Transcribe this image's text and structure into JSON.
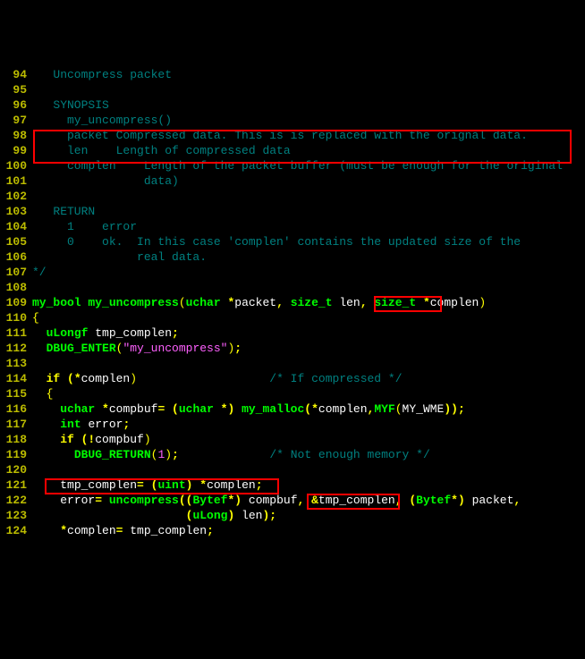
{
  "lines": [
    {
      "n": "94",
      "segs": [
        {
          "t": "   Uncompress packet",
          "c": "comment"
        }
      ]
    },
    {
      "n": "95",
      "segs": [
        {
          "t": " ",
          "c": "comment"
        }
      ]
    },
    {
      "n": "96",
      "segs": [
        {
          "t": "   SYNOPSIS",
          "c": "comment"
        }
      ]
    },
    {
      "n": "97",
      "segs": [
        {
          "t": "     my_uncompress()",
          "c": "comment"
        }
      ]
    },
    {
      "n": "98",
      "segs": [
        {
          "t": "     packet Compressed data. This is is replaced with the orignal data.",
          "c": "comment"
        }
      ]
    },
    {
      "n": "99",
      "segs": [
        {
          "t": "     len    Length of compressed data",
          "c": "comment"
        }
      ]
    },
    {
      "n": "100",
      "segs": [
        {
          "t": "     complen    Length of the packet buffer (must be enough for the original",
          "c": "comment"
        }
      ]
    },
    {
      "n": "101",
      "segs": [
        {
          "t": "                data)",
          "c": "comment"
        }
      ]
    },
    {
      "n": "102",
      "segs": [
        {
          "t": " ",
          "c": "comment"
        }
      ]
    },
    {
      "n": "103",
      "segs": [
        {
          "t": "   RETURN",
          "c": "comment"
        }
      ]
    },
    {
      "n": "104",
      "segs": [
        {
          "t": "     1    error",
          "c": "comment"
        }
      ]
    },
    {
      "n": "105",
      "segs": [
        {
          "t": "     0    ok.  In this case 'complen' contains the updated size of the",
          "c": "comment"
        }
      ]
    },
    {
      "n": "106",
      "segs": [
        {
          "t": "               real data.",
          "c": "comment"
        }
      ]
    },
    {
      "n": "107",
      "segs": [
        {
          "t": "*/",
          "c": "comment"
        }
      ]
    },
    {
      "n": "108",
      "segs": [
        {
          "t": " ",
          "c": "comment"
        }
      ]
    },
    {
      "n": "109",
      "segs": [
        {
          "t": "my_bool ",
          "c": "kw-type"
        },
        {
          "t": "my_uncompress",
          "c": "func"
        },
        {
          "t": "(",
          "c": "paren"
        },
        {
          "t": "uchar ",
          "c": "kw-type"
        },
        {
          "t": "*",
          "c": "punct"
        },
        {
          "t": "packet",
          "c": "ident"
        },
        {
          "t": ", ",
          "c": "punct"
        },
        {
          "t": "size_t ",
          "c": "kw-type"
        },
        {
          "t": "len",
          "c": "ident"
        },
        {
          "t": ", ",
          "c": "punct"
        },
        {
          "t": "size_t ",
          "c": "kw-type"
        },
        {
          "t": "*",
          "c": "punct"
        },
        {
          "t": "complen",
          "c": "ident"
        },
        {
          "t": ")",
          "c": "paren"
        }
      ]
    },
    {
      "n": "110",
      "segs": [
        {
          "t": "{",
          "c": "brace"
        }
      ]
    },
    {
      "n": "111",
      "segs": [
        {
          "t": "  ",
          "c": "ident"
        },
        {
          "t": "uLongf ",
          "c": "kw-type"
        },
        {
          "t": "tmp_complen",
          "c": "ident"
        },
        {
          "t": ";",
          "c": "punct"
        }
      ]
    },
    {
      "n": "112",
      "segs": [
        {
          "t": "  ",
          "c": "ident"
        },
        {
          "t": "DBUG_ENTER",
          "c": "func"
        },
        {
          "t": "(",
          "c": "paren"
        },
        {
          "t": "\"my_uncompress\"",
          "c": "str"
        },
        {
          "t": ")",
          "c": "paren"
        },
        {
          "t": ";",
          "c": "punct"
        }
      ]
    },
    {
      "n": "113",
      "segs": [
        {
          "t": " ",
          "c": "ident"
        }
      ]
    },
    {
      "n": "114",
      "segs": [
        {
          "t": "  ",
          "c": "ident"
        },
        {
          "t": "if ",
          "c": "kw-ctrl"
        },
        {
          "t": "(*",
          "c": "punct"
        },
        {
          "t": "complen",
          "c": "ident"
        },
        {
          "t": ")",
          "c": "paren"
        },
        {
          "t": "                   ",
          "c": "ident"
        },
        {
          "t": "/* If compressed */",
          "c": "comment"
        }
      ]
    },
    {
      "n": "115",
      "segs": [
        {
          "t": "  ",
          "c": "ident"
        },
        {
          "t": "{",
          "c": "brace"
        }
      ]
    },
    {
      "n": "116",
      "segs": [
        {
          "t": "    ",
          "c": "ident"
        },
        {
          "t": "uchar ",
          "c": "kw-type"
        },
        {
          "t": "*",
          "c": "punct"
        },
        {
          "t": "compbuf",
          "c": "ident"
        },
        {
          "t": "= (",
          "c": "punct"
        },
        {
          "t": "uchar ",
          "c": "kw-type"
        },
        {
          "t": "*) ",
          "c": "punct"
        },
        {
          "t": "my_malloc",
          "c": "func"
        },
        {
          "t": "(*",
          "c": "punct"
        },
        {
          "t": "complen",
          "c": "ident"
        },
        {
          "t": ",",
          "c": "punct"
        },
        {
          "t": "MYF",
          "c": "func"
        },
        {
          "t": "(",
          "c": "paren"
        },
        {
          "t": "MY_WME",
          "c": "ident"
        },
        {
          "t": "));",
          "c": "punct"
        }
      ]
    },
    {
      "n": "117",
      "segs": [
        {
          "t": "    ",
          "c": "ident"
        },
        {
          "t": "int ",
          "c": "kw-type"
        },
        {
          "t": "error",
          "c": "ident"
        },
        {
          "t": ";",
          "c": "punct"
        }
      ]
    },
    {
      "n": "118",
      "segs": [
        {
          "t": "    ",
          "c": "ident"
        },
        {
          "t": "if ",
          "c": "kw-ctrl"
        },
        {
          "t": "(!",
          "c": "punct"
        },
        {
          "t": "compbuf",
          "c": "ident"
        },
        {
          "t": ")",
          "c": "paren"
        }
      ]
    },
    {
      "n": "119",
      "segs": [
        {
          "t": "      ",
          "c": "ident"
        },
        {
          "t": "DBUG_RETURN",
          "c": "func"
        },
        {
          "t": "(",
          "c": "paren"
        },
        {
          "t": "1",
          "c": "num"
        },
        {
          "t": ")",
          "c": "paren"
        },
        {
          "t": ";",
          "c": "punct"
        },
        {
          "t": "             ",
          "c": "ident"
        },
        {
          "t": "/* Not enough memory */",
          "c": "comment"
        }
      ]
    },
    {
      "n": "120",
      "segs": [
        {
          "t": " ",
          "c": "ident"
        }
      ]
    },
    {
      "n": "121",
      "segs": [
        {
          "t": "    ",
          "c": "ident"
        },
        {
          "t": "tmp_complen",
          "c": "ident"
        },
        {
          "t": "= (",
          "c": "punct"
        },
        {
          "t": "uint",
          "c": "kw-type"
        },
        {
          "t": ") *",
          "c": "punct"
        },
        {
          "t": "complen",
          "c": "ident"
        },
        {
          "t": ";",
          "c": "punct"
        }
      ]
    },
    {
      "n": "122",
      "segs": [
        {
          "t": "    ",
          "c": "ident"
        },
        {
          "t": "error",
          "c": "ident"
        },
        {
          "t": "= ",
          "c": "punct"
        },
        {
          "t": "uncompress",
          "c": "func"
        },
        {
          "t": "((",
          "c": "punct"
        },
        {
          "t": "Bytef",
          "c": "kw-type"
        },
        {
          "t": "*) ",
          "c": "punct"
        },
        {
          "t": "compbuf",
          "c": "ident"
        },
        {
          "t": ", &",
          "c": "punct"
        },
        {
          "t": "tmp_complen",
          "c": "ident"
        },
        {
          "t": ", (",
          "c": "punct"
        },
        {
          "t": "Bytef",
          "c": "kw-type"
        },
        {
          "t": "*) ",
          "c": "punct"
        },
        {
          "t": "packet",
          "c": "ident"
        },
        {
          "t": ",",
          "c": "punct"
        }
      ]
    },
    {
      "n": "123",
      "segs": [
        {
          "t": "                      (",
          "c": "punct"
        },
        {
          "t": "uLong",
          "c": "kw-type"
        },
        {
          "t": ") ",
          "c": "punct"
        },
        {
          "t": "len",
          "c": "ident"
        },
        {
          "t": ");",
          "c": "punct"
        }
      ]
    },
    {
      "n": "124",
      "segs": [
        {
          "t": "    *",
          "c": "punct"
        },
        {
          "t": "complen",
          "c": "ident"
        },
        {
          "t": "= ",
          "c": "punct"
        },
        {
          "t": "tmp_complen",
          "c": "ident"
        },
        {
          "t": ";",
          "c": "punct"
        }
      ]
    }
  ]
}
